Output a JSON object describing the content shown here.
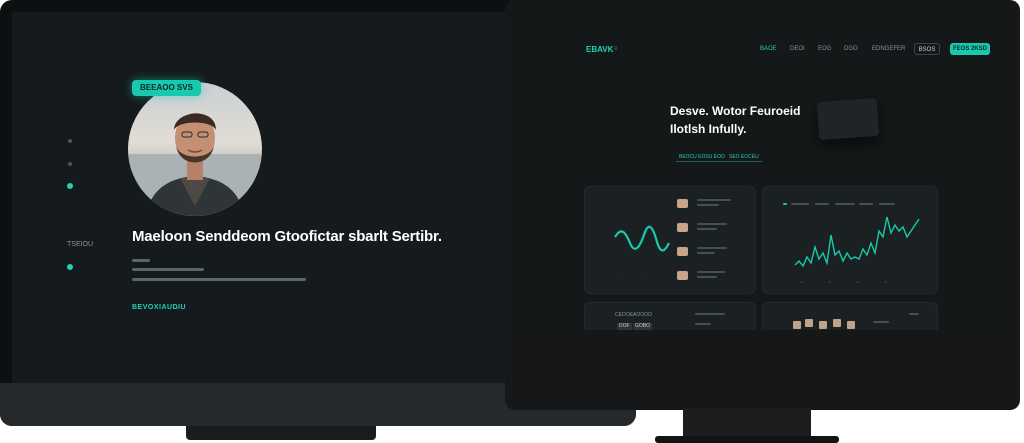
{
  "left_page": {
    "badge": "BEEAOO SVS",
    "headline": "Maeloon Senddeom Gtoofictar sbarlt Sertibr.",
    "side_label": "TSEIOU",
    "cta": "BEVOXIAUDIU"
  },
  "right_page": {
    "logo": "EBAVK",
    "nav": [
      "BAOE",
      "DEOI",
      "EOG",
      "DGO",
      "EDNGEFER"
    ],
    "nav_ghost_button": "BSOS",
    "nav_primary_button": "FEOS 2KSD",
    "title_line1": "Desve. Wotor Feuroeid",
    "title_line2": "Ilotlsh Infully.",
    "chips": [
      "BEOCU EOSU EOO",
      "SEO EOCEU"
    ],
    "bottom_left_label": "CEOOEAOOOO",
    "bottom_left_cells": [
      "DOF",
      "GOBO"
    ]
  },
  "colors": {
    "accent": "#18c9ae",
    "background": "#151a1c",
    "panel": "#1b2123"
  }
}
